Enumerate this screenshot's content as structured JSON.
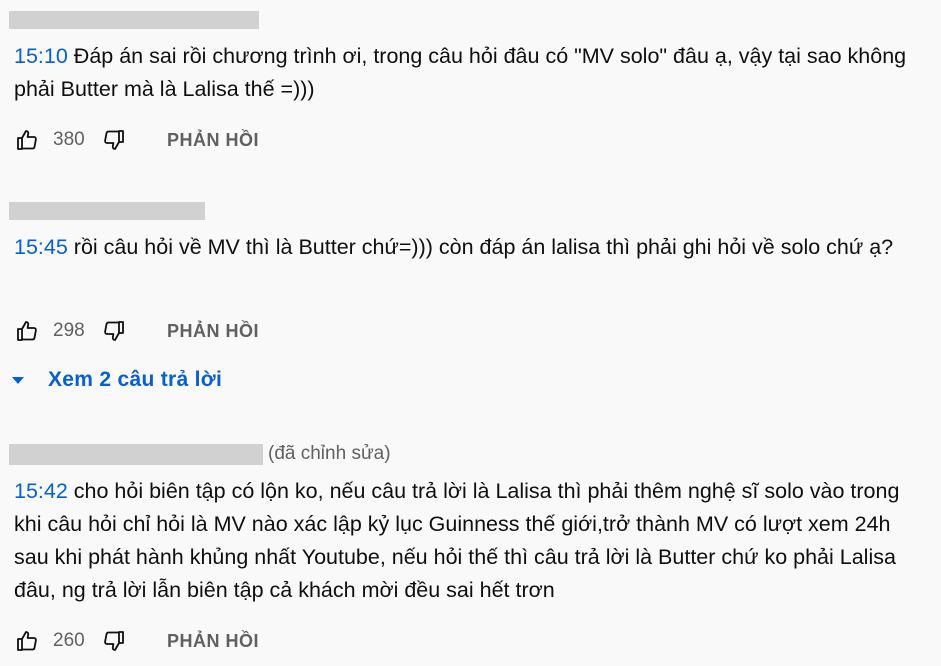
{
  "comments": [
    {
      "author_redacted": true,
      "edited_label": "",
      "timestamp": "15:10",
      "text": " Đáp án sai rồi chương trình ơi, trong câu hỏi đâu có \"MV solo\" đâu ạ, vậy tại sao không phải Butter mà là Lalisa thế =)))",
      "likes": "380",
      "reply_label": "PHẢN HỒI"
    },
    {
      "author_redacted": true,
      "edited_label": "",
      "timestamp": "15:45",
      "text": " rồi câu hỏi về MV thì là Butter chứ=))) còn đáp án lalisa thì phải ghi hỏi về solo chứ ạ?",
      "likes": "298",
      "reply_label": "PHẢN HỒI",
      "view_replies_label": "Xem 2 câu trả lời"
    },
    {
      "author_redacted": true,
      "edited_label": "(đã chỉnh sửa)",
      "timestamp": "15:42",
      "text": " cho hỏi biên tập có lộn ko, nếu câu trả lời là Lalisa thì phải thêm nghệ sĩ solo vào trong khi câu hỏi chỉ hỏi là MV nào xác lập kỷ lục Guinness thế giới,trở thành MV có lượt xem 24h sau khi phát hành khủng nhất Youtube, nếu hỏi thế thì câu trả lời là Butter chứ ko phải Lalisa đâu, ng trả lời lẫn biên tập cả khách mời đều sai hết trơn",
      "likes": "260",
      "reply_label": "PHẢN HỒI"
    }
  ],
  "icons": {
    "like": "thumbs-up-icon",
    "dislike": "thumbs-down-icon",
    "expand": "caret-down-icon"
  },
  "colors": {
    "timestamp_link": "#065fd4",
    "secondary_text": "#606060",
    "redaction": "#d1d1d1",
    "background": "#f9f9f9"
  }
}
